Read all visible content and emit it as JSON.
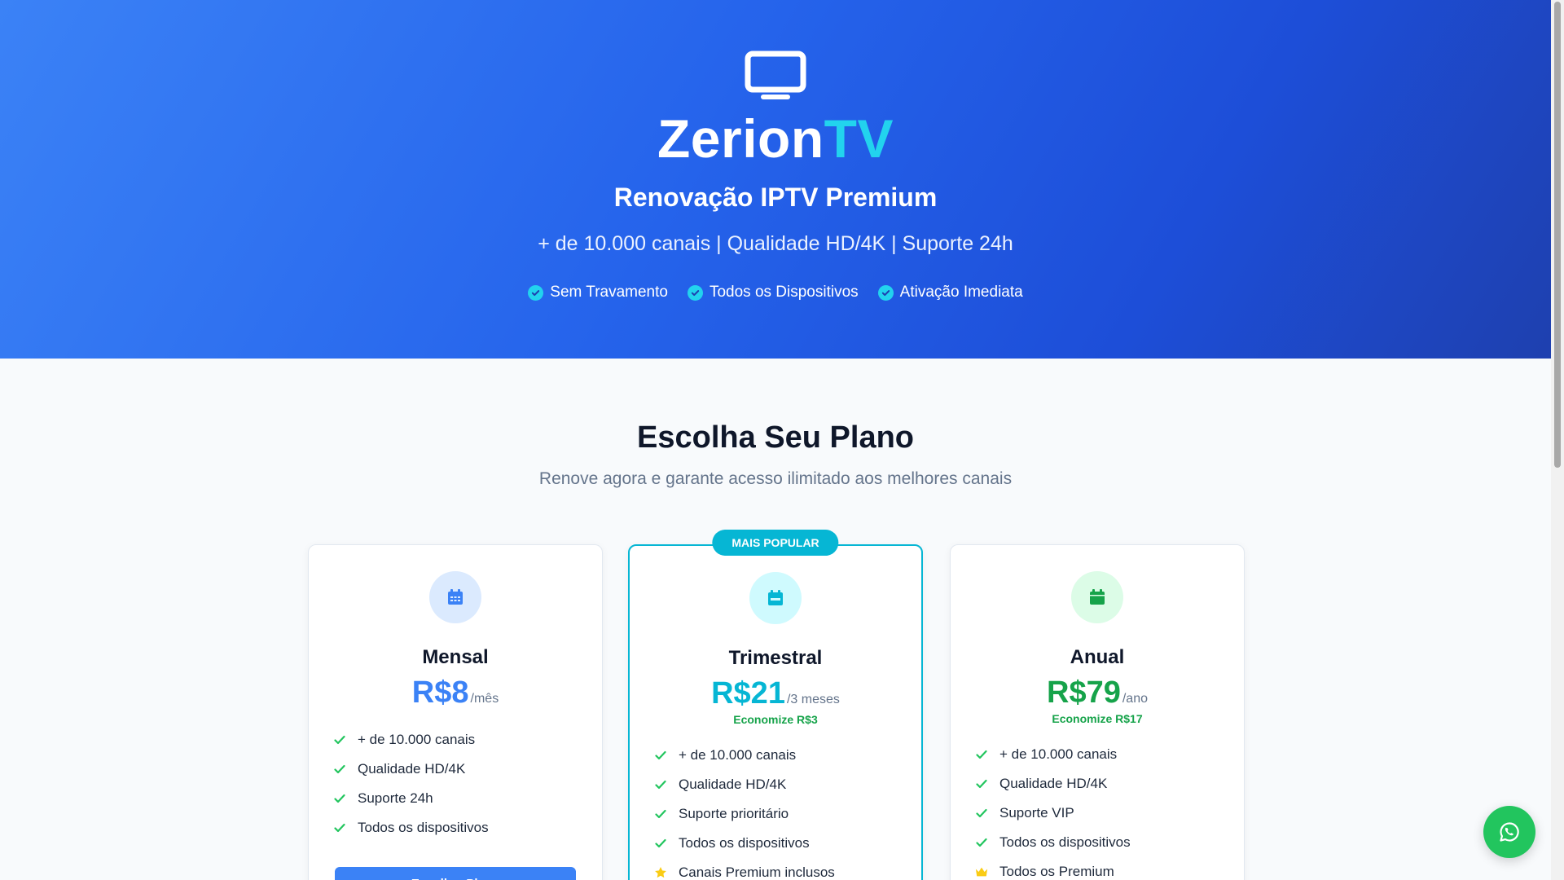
{
  "hero": {
    "brand_main": "Zerion",
    "brand_accent": "TV",
    "subtitle": "Renovação IPTV Premium",
    "tagline": "+ de 10.000 canais | Qualidade HD/4K | Suporte 24h",
    "badges": [
      "Sem Travamento",
      "Todos os Dispositivos",
      "Ativação Imediata"
    ],
    "icon": "tv-icon"
  },
  "plans_section": {
    "title": "Escolha Seu Plano",
    "subtitle": "Renove agora e garante acesso ilimitado aos melhores canais"
  },
  "plans": [
    {
      "name": "Mensal",
      "price": "R$8",
      "period": "/mês",
      "savings": "",
      "icon": "calendar-icon",
      "features": [
        "+ de 10.000 canais",
        "Qualidade HD/4K",
        "Suporte 24h",
        "Todos os dispositivos"
      ],
      "button": "Escolher Plano"
    },
    {
      "name": "Trimestral",
      "price": "R$21",
      "period": "/3 meses",
      "savings": "Economize R$3",
      "badge": "MAIS POPULAR",
      "icon": "calendar-week-icon",
      "features": [
        "+ de 10.000 canais",
        "Qualidade HD/4K",
        "Suporte prioritário",
        "Todos os dispositivos",
        "Canais Premium inclusos"
      ]
    },
    {
      "name": "Anual",
      "price": "R$79",
      "period": "/ano",
      "savings": "Economize R$17",
      "icon": "calendar-filled-icon",
      "features": [
        "+ de 10.000 canais",
        "Qualidade HD/4K",
        "Suporte VIP",
        "Todos os dispositivos",
        "Todos os Premium"
      ]
    }
  ],
  "colors": {
    "primary": "#3b82f6",
    "accent": "#06b6d4",
    "success": "#16a34a",
    "whatsapp": "#22c55e"
  },
  "floating": {
    "icon": "whatsapp-icon"
  }
}
